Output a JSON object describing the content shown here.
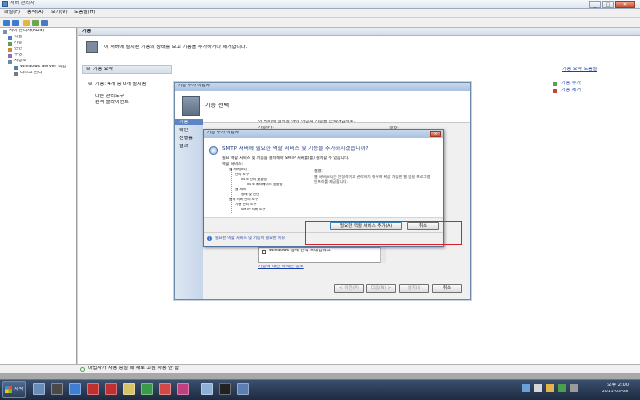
{
  "window": {
    "title": "서버 관리자"
  },
  "menu": [
    "파일(F)",
    "동작(A)",
    "보기(V)",
    "도움말(H)"
  ],
  "tree": {
    "root": "서버 관리자(RDS)",
    "items": [
      "역할",
      "기능",
      "진단",
      "구성",
      "저장소"
    ],
    "subitems": [
      "Windows Server 백업",
      "디스크 관리"
    ]
  },
  "content": {
    "header": "기능",
    "banner": "이 서버에 설치된 기능의 상태를 보고 기능을 추가하거나 제거합니다.",
    "section_title": "기능 요약",
    "summary_line": "기능: 4개 중 0개 설치됨",
    "sub_line1": "다른 관리도구",
    "sub_line2": "원격 클라이언트",
    "right_links": [
      "기능 요약 도움말",
      "기능 추가",
      "기능 제거"
    ]
  },
  "wizard": {
    "title": "기능 추가 마법사",
    "heading": "기능 선택",
    "nav": [
      "기능",
      "확인",
      "진행률",
      "결과"
    ],
    "instruction": "이 서버에 설치할 하나 이상의 기능을 선택하십시오.",
    "col_features": "기능(F):",
    "col_desc": "설명:",
    "list_item": "Windows 생체 인식 프레임워크",
    "more_link": "기능에 대한 자세한 정보",
    "buttons": [
      "< 이전(P)",
      "다음(N) >",
      "설치(I)",
      "취소"
    ]
  },
  "dialog": {
    "title": "기능 추가 마법사",
    "question": "SMTP 서버에 필요한 역할 서비스 및 기능을 추가하시겠습니까?",
    "detail": "필요 역할 서비스 및 기능을 설치해야 SMTP 서버를(를) 설치할 수 있습니다.",
    "list_heading": "역할 서비스:",
    "tree": [
      "웹 서버(IIS)",
      "관리 도구",
      "IIS 6 관리 호환성",
      "IIS 6 메타베이스 호환성",
      "웹 서버",
      "상태 및 진단",
      "원격 서버 관리 도구",
      "기능 관리 도구",
      "SMTP 서버 도구"
    ],
    "desc_heading": "설명:",
    "desc_text": "웹 서버(IIS)는 안정적이고 관리하기 쉬우며 확장 가능한 웹 응용 프로그램 인프라를 제공합니다.",
    "add_button": "필요한 역할 서비스 추가(A)",
    "cancel_button": "취소",
    "bottom_link": "필요한 역할 서비스 및 기능이 필요한 이유"
  },
  "status_bar": "마법사가 사용 중일 때 새로 고침 사용 안 함",
  "taskbar": {
    "start": "시작",
    "clock_time": "오후 2:00",
    "clock_date": "2011-03-08"
  },
  "colors": {
    "highlight_box": "#d9202b",
    "link": "#1a3fa8"
  }
}
